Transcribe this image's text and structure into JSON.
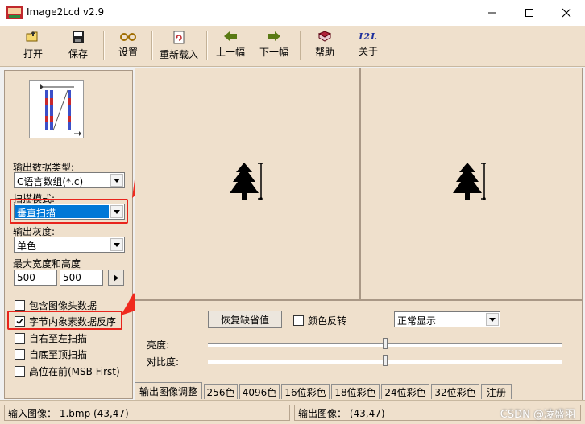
{
  "window": {
    "title": "Image2Lcd v2.9",
    "controls": {
      "minimize": "minimize-icon",
      "maximize": "maximize-icon",
      "close": "close-icon"
    }
  },
  "toolbar": {
    "open": "打开",
    "save": "保存",
    "settings": "设置",
    "reload": "重新载入",
    "prev": "上一幅",
    "next": "下一幅",
    "help": "帮助",
    "about": "关于",
    "about_icon_text": "I2L"
  },
  "left_panel": {
    "output_type_label": "输出数据类型:",
    "output_type_value": "C语言数组(*.c)",
    "scan_mode_label": "扫描模式:",
    "scan_mode_value": "垂直扫描",
    "gray_label": "输出灰度:",
    "gray_value": "单色",
    "max_size_label": "最大宽度和高度",
    "max_width": "500",
    "max_height": "500",
    "options": [
      {
        "label": "包含图像头数据",
        "checked": false
      },
      {
        "label": "字节内象素数据反序",
        "checked": true
      },
      {
        "label": "自右至左扫描",
        "checked": false
      },
      {
        "label": "自底至顶扫描",
        "checked": false
      },
      {
        "label": "高位在前(MSB First)",
        "checked": false
      }
    ]
  },
  "controls": {
    "restore_default": "恢复缺省值",
    "invert_color": "颜色反转",
    "display_mode": "正常显示",
    "brightness_label": "亮度:",
    "contrast_label": "对比度:",
    "brightness_level": 0.5,
    "contrast_level": 0.5
  },
  "tabs": [
    "输出图像调整",
    "256色",
    "4096色",
    "16位彩色",
    "18位彩色",
    "24位彩色",
    "32位彩色",
    "注册"
  ],
  "status": {
    "input_image": "输入图像：  1.bmp (43,47)",
    "output_image": "输出图像：  (43,47)"
  },
  "watermark": "CSDN @凌盛羽",
  "colors": {
    "panel": "#efe0cc",
    "highlight": "#e8241c",
    "selection": "#0078d7"
  }
}
